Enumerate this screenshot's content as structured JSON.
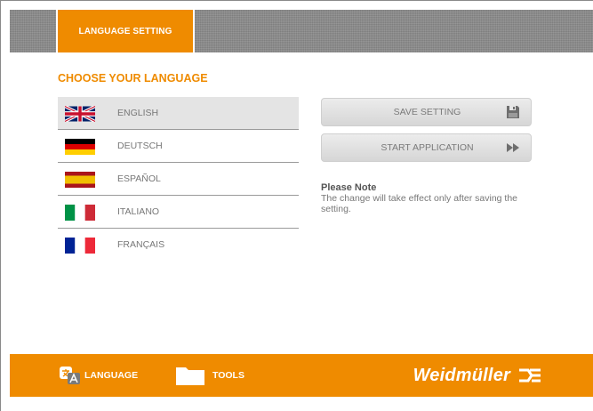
{
  "header": {
    "tab_label": "LANGUAGE SETTING"
  },
  "main": {
    "heading": "CHOOSE YOUR LANGUAGE",
    "languages": [
      {
        "label": "ENGLISH",
        "flag": "uk-flag-icon",
        "selected": true
      },
      {
        "label": "DEUTSCH",
        "flag": "germany-flag-icon",
        "selected": false
      },
      {
        "label": "ESPAÑOL",
        "flag": "spain-flag-icon",
        "selected": false
      },
      {
        "label": "ITALIANO",
        "flag": "italy-flag-icon",
        "selected": false
      },
      {
        "label": "FRANÇAIS",
        "flag": "france-flag-icon",
        "selected": false
      }
    ],
    "buttons": {
      "save_label": "SAVE SETTING",
      "save_icon": "floppy-disk-icon",
      "start_label": "START APPLICATION",
      "start_icon": "fast-forward-icon"
    },
    "note": {
      "title": "Please Note",
      "text": "The change will take effect only after saving the setting."
    }
  },
  "footer": {
    "language_label": "LANGUAGE",
    "language_icon": "translate-icon",
    "tools_label": "TOOLS",
    "tools_icon": "folder-icon",
    "brand": "Weidmüller",
    "brand_icon": "weidmuller-logo-icon"
  },
  "colors": {
    "accent": "#ef8b00",
    "topbar": "#8a8a8a",
    "selected_row": "#e4e4e4",
    "text_gray": "#777777"
  }
}
